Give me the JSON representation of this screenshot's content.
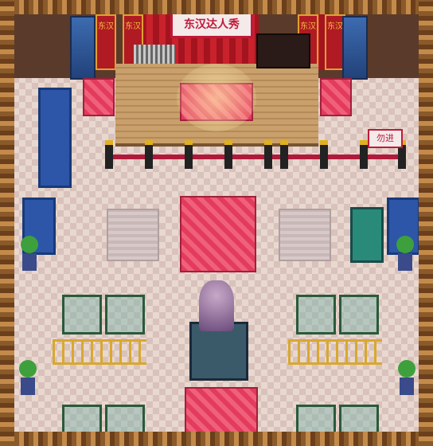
{
  "scene": {
    "type": "pixel-art-game-map",
    "theme": "museum-theater"
  },
  "sign": {
    "text": "东汉达人秀"
  },
  "reserved_sign": {
    "text": "勿进"
  },
  "banners": {
    "text": "东汉"
  },
  "colors": {
    "floor_light": "#e9d8cf",
    "floor_dark": "#d9c2bb",
    "curtain": "#c8222c",
    "rug_pink": "#e23b5c",
    "door_blue": "#3d6bb0",
    "gold": "#e0b020",
    "rope": "#b01a3a"
  },
  "icons": [
    "statue-icon",
    "piano-icon",
    "harp-icon",
    "plant-icon",
    "display-case-icon",
    "rope-post-icon",
    "door-icon"
  ]
}
